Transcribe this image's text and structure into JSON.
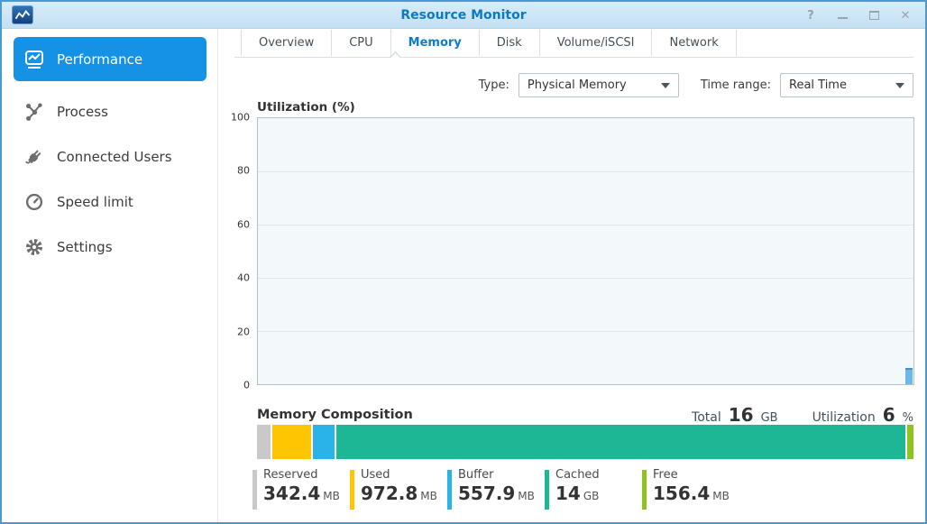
{
  "window": {
    "title": "Resource Monitor",
    "controls": {
      "help": "?",
      "close": "✕"
    }
  },
  "sidebar": {
    "items": [
      {
        "label": "Performance",
        "selected": true
      },
      {
        "label": "Process"
      },
      {
        "label": "Connected Users"
      },
      {
        "label": "Speed limit"
      },
      {
        "label": "Settings"
      }
    ]
  },
  "tabs": [
    {
      "label": "Overview"
    },
    {
      "label": "CPU"
    },
    {
      "label": "Memory",
      "selected": true
    },
    {
      "label": "Disk"
    },
    {
      "label": "Volume/iSCSI"
    },
    {
      "label": "Network"
    }
  ],
  "filters": {
    "type_label": "Type:",
    "type_value": "Physical Memory",
    "time_label": "Time range:",
    "time_value": "Real Time"
  },
  "chart_data": [
    {
      "id": "memory-utilization",
      "type": "bar",
      "title": "Utilization (%)",
      "x_mode": "real-time",
      "ylim": [
        0,
        100
      ],
      "yticks": [
        0,
        20,
        40,
        60,
        80,
        100
      ],
      "grid": true,
      "legend_position": "none",
      "series": [
        {
          "name": "Physical Memory utilization",
          "values": [
            6
          ],
          "color": "#6ab9e9"
        }
      ]
    },
    {
      "id": "memory-composition",
      "type": "bar",
      "subtype": "stacked-horizontal-single-bar",
      "title": "Memory Composition",
      "total": {
        "label": "Total",
        "value": "16",
        "unit": "GB"
      },
      "utilization": {
        "label": "Utilization",
        "value": "6",
        "unit": "%"
      },
      "segments": [
        {
          "name": "Reserved",
          "value": "342.4",
          "unit": "MB",
          "mb": 342.4,
          "color": "#c9c9c9"
        },
        {
          "name": "Used",
          "value": "972.8",
          "unit": "MB",
          "mb": 972.8,
          "color": "#fdc502"
        },
        {
          "name": "Buffer",
          "value": "557.9",
          "unit": "MB",
          "mb": 557.9,
          "color": "#2ab3e8"
        },
        {
          "name": "Cached",
          "value": "14",
          "unit": "GB",
          "mb": 14336,
          "color": "#1db795"
        },
        {
          "name": "Free",
          "value": "156.4",
          "unit": "MB",
          "mb": 156.4,
          "color": "#8fc31f"
        }
      ]
    }
  ]
}
